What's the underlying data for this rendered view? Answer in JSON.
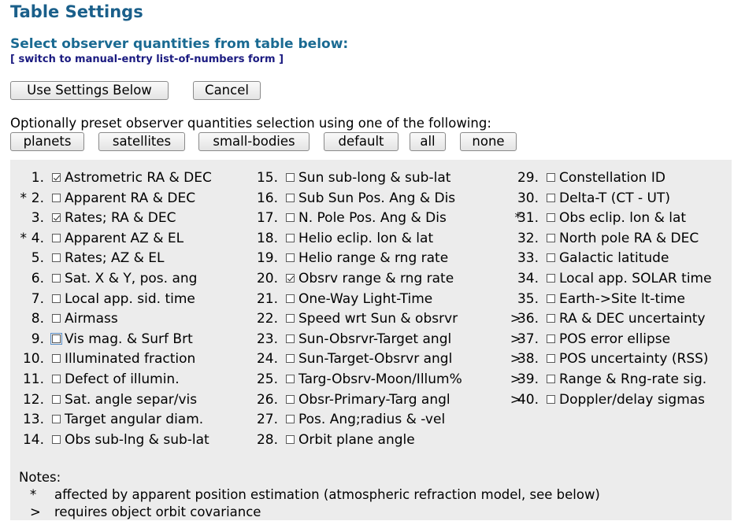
{
  "header": {
    "title": "Table Settings",
    "subtitle": "Select observer quantities from table below:",
    "switch_link": "[ switch to manual-entry list-of-numbers form ]"
  },
  "actions": {
    "use_settings": "Use Settings Below",
    "cancel": "Cancel"
  },
  "presets": {
    "label": "Optionally preset observer quantities selection using one of the following:",
    "buttons": [
      "planets",
      "satellites",
      "small-bodies",
      "default",
      "all",
      "none"
    ]
  },
  "quantities": [
    {
      "num": "1.",
      "mark": "",
      "label": "Astrometric RA & DEC",
      "checked": true
    },
    {
      "num": "2.",
      "mark": "*",
      "label": "Apparent RA & DEC",
      "checked": false
    },
    {
      "num": "3.",
      "mark": "",
      "label": "Rates; RA & DEC",
      "checked": true
    },
    {
      "num": "4.",
      "mark": "*",
      "label": "Apparent AZ & EL",
      "checked": false
    },
    {
      "num": "5.",
      "mark": "",
      "label": "Rates; AZ & EL",
      "checked": false
    },
    {
      "num": "6.",
      "mark": "",
      "label": "Sat. X & Y, pos. ang",
      "checked": false
    },
    {
      "num": "7.",
      "mark": "",
      "label": "Local app. sid. time",
      "checked": false
    },
    {
      "num": "8.",
      "mark": "",
      "label": "Airmass",
      "checked": false
    },
    {
      "num": "9.",
      "mark": "",
      "label": "Vis mag. & Surf Brt",
      "checked": false,
      "focused": true
    },
    {
      "num": "10.",
      "mark": "",
      "label": "Illuminated fraction",
      "checked": false
    },
    {
      "num": "11.",
      "mark": "",
      "label": "Defect of illumin.",
      "checked": false
    },
    {
      "num": "12.",
      "mark": "",
      "label": "Sat. angle separ/vis",
      "checked": false
    },
    {
      "num": "13.",
      "mark": "",
      "label": "Target angular diam.",
      "checked": false
    },
    {
      "num": "14.",
      "mark": "",
      "label": "Obs sub-lng & sub-lat",
      "checked": false
    },
    {
      "num": "15.",
      "mark": "",
      "label": "Sun sub-long & sub-lat",
      "checked": false
    },
    {
      "num": "16.",
      "mark": "",
      "label": "Sub Sun Pos. Ang & Dis",
      "checked": false
    },
    {
      "num": "17.",
      "mark": "",
      "label": "N. Pole Pos. Ang & Dis",
      "checked": false
    },
    {
      "num": "18.",
      "mark": "",
      "label": "Helio eclip. lon & lat",
      "checked": false
    },
    {
      "num": "19.",
      "mark": "",
      "label": "Helio range & rng rate",
      "checked": false
    },
    {
      "num": "20.",
      "mark": "",
      "label": "Obsrv range & rng rate",
      "checked": true
    },
    {
      "num": "21.",
      "mark": "",
      "label": "One-Way Light-Time",
      "checked": false
    },
    {
      "num": "22.",
      "mark": "",
      "label": "Speed wrt Sun & obsrvr",
      "checked": false
    },
    {
      "num": "23.",
      "mark": "",
      "label": "Sun-Obsrvr-Target angl",
      "checked": false
    },
    {
      "num": "24.",
      "mark": "",
      "label": "Sun-Target-Obsrvr angl",
      "checked": false
    },
    {
      "num": "25.",
      "mark": "",
      "label": "Targ-Obsrv-Moon/Illum%",
      "checked": false
    },
    {
      "num": "26.",
      "mark": "",
      "label": "Obsr-Primary-Targ angl",
      "checked": false
    },
    {
      "num": "27.",
      "mark": "",
      "label": "Pos. Ang;radius & -vel",
      "checked": false
    },
    {
      "num": "28.",
      "mark": "",
      "label": "Orbit plane angle",
      "checked": false
    },
    {
      "num": "29.",
      "mark": "",
      "label": "Constellation ID",
      "checked": false
    },
    {
      "num": "30.",
      "mark": "",
      "label": "Delta-T (CT - UT)",
      "checked": false
    },
    {
      "num": "31.",
      "mark": "*",
      "label": "Obs eclip. lon & lat",
      "checked": false
    },
    {
      "num": "32.",
      "mark": "",
      "label": "North pole RA & DEC",
      "checked": false
    },
    {
      "num": "33.",
      "mark": "",
      "label": "Galactic latitude",
      "checked": false
    },
    {
      "num": "34.",
      "mark": "",
      "label": "Local app. SOLAR time",
      "checked": false
    },
    {
      "num": "35.",
      "mark": "",
      "label": "Earth->Site lt-time",
      "checked": false
    },
    {
      "num": "36.",
      "mark": ">",
      "label": "RA & DEC uncertainty",
      "checked": false
    },
    {
      "num": "37.",
      "mark": ">",
      "label": "POS error ellipse",
      "checked": false
    },
    {
      "num": "38.",
      "mark": ">",
      "label": "POS uncertainty (RSS)",
      "checked": false
    },
    {
      "num": "39.",
      "mark": ">",
      "label": "Range & Rng-rate sig.",
      "checked": false
    },
    {
      "num": "40.",
      "mark": ">",
      "label": "Doppler/delay sigmas",
      "checked": false
    }
  ],
  "notes": {
    "heading": "Notes:",
    "items": [
      {
        "symbol": "*",
        "text": "affected by apparent position estimation (atmospheric refraction model, see below)"
      },
      {
        "symbol": ">",
        "text": "requires object orbit covariance"
      }
    ]
  }
}
